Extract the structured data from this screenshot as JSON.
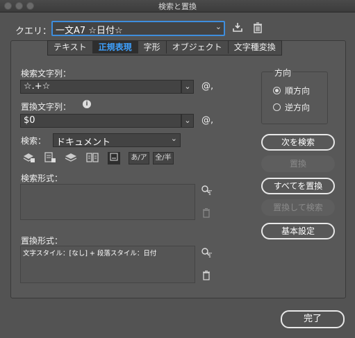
{
  "window": {
    "title": "検索と置換"
  },
  "query": {
    "label": "クエリ：",
    "value": "一文A7 ☆日付☆"
  },
  "tabs": [
    {
      "label": "テキスト",
      "active": false
    },
    {
      "label": "正規表現",
      "active": true
    },
    {
      "label": "字形",
      "active": false
    },
    {
      "label": "オブジェクト",
      "active": false
    },
    {
      "label": "文字種変換",
      "active": false
    }
  ],
  "find": {
    "label": "検索文字列：",
    "value": "☆.+☆",
    "special": "@,"
  },
  "replace": {
    "label": "置換文字列：",
    "value": "$0",
    "special": "@,"
  },
  "search_scope": {
    "label": "検索：",
    "value": "ドキュメント"
  },
  "options": {
    "kana": "あ/ア",
    "width": "全/半"
  },
  "find_format": {
    "label": "検索形式：",
    "value": ""
  },
  "replace_format": {
    "label": "置換形式：",
    "value": "文字スタイル：[なし] + 段落スタイル：日付"
  },
  "direction": {
    "label": "方向",
    "forward": "順方向",
    "backward": "逆方向",
    "selected": "forward"
  },
  "buttons": {
    "find_next": "次を検索",
    "replace": "置換",
    "replace_all": "すべてを置換",
    "replace_find": "置換して検索",
    "basic": "基本設定",
    "done": "完了"
  }
}
